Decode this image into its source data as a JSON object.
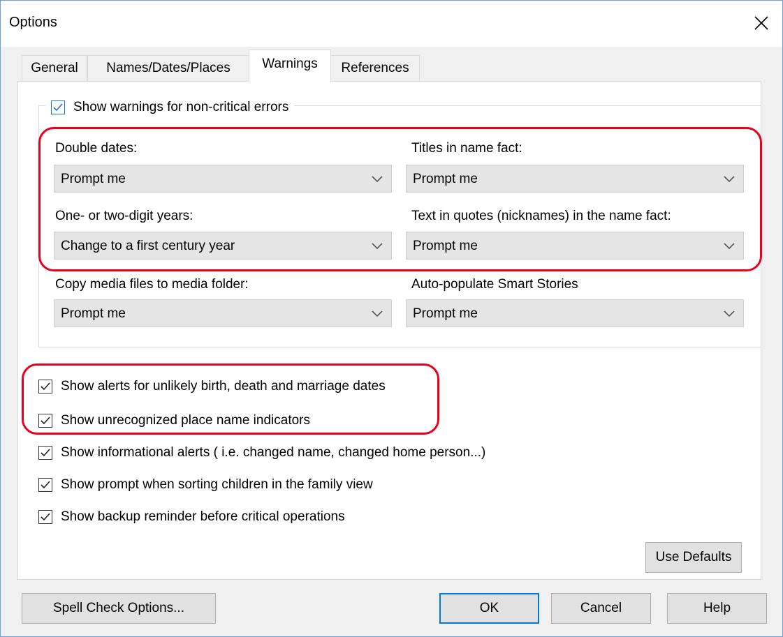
{
  "window": {
    "title": "Options"
  },
  "tabs": [
    {
      "label": "General",
      "active": false
    },
    {
      "label": "Names/Dates/Places",
      "active": false
    },
    {
      "label": "Warnings",
      "active": true
    },
    {
      "label": "References",
      "active": false
    }
  ],
  "warnings_group": {
    "label": "Show warnings for non-critical errors",
    "checked": true,
    "fields": {
      "double_dates": {
        "label": "Double dates:",
        "value": "Prompt me"
      },
      "titles_in_name": {
        "label": "Titles in name fact:",
        "value": "Prompt me"
      },
      "short_years": {
        "label": "One- or two-digit years:",
        "value": "Change to a first century year"
      },
      "quotes_in_name": {
        "label": "Text in quotes (nicknames) in the name fact:",
        "value": "Prompt me"
      },
      "copy_media": {
        "label": "Copy media files to media folder:",
        "value": "Prompt me"
      },
      "smart_stories": {
        "label": "Auto-populate Smart Stories",
        "value": "Prompt me"
      }
    }
  },
  "checkboxes": [
    {
      "label": "Show alerts for unlikely birth, death and marriage dates",
      "checked": true
    },
    {
      "label": "Show unrecognized place name indicators",
      "checked": true
    },
    {
      "label": "Show informational alerts ( i.e. changed name, changed home person...)",
      "checked": true
    },
    {
      "label": "Show prompt when sorting children in the family view",
      "checked": true
    },
    {
      "label": "Show backup reminder before critical operations",
      "checked": true
    }
  ],
  "buttons": {
    "use_defaults": "Use Defaults",
    "spell_check": "Spell Check Options...",
    "ok": "OK",
    "cancel": "Cancel",
    "help": "Help"
  },
  "colors": {
    "highlight": "#e8001c",
    "focus_border": "#0078d7",
    "checkbox_focus": "#1f6fd1"
  },
  "icons": {
    "close": "close-icon",
    "chevron": "chevron-down-icon",
    "check": "checkmark-icon"
  }
}
